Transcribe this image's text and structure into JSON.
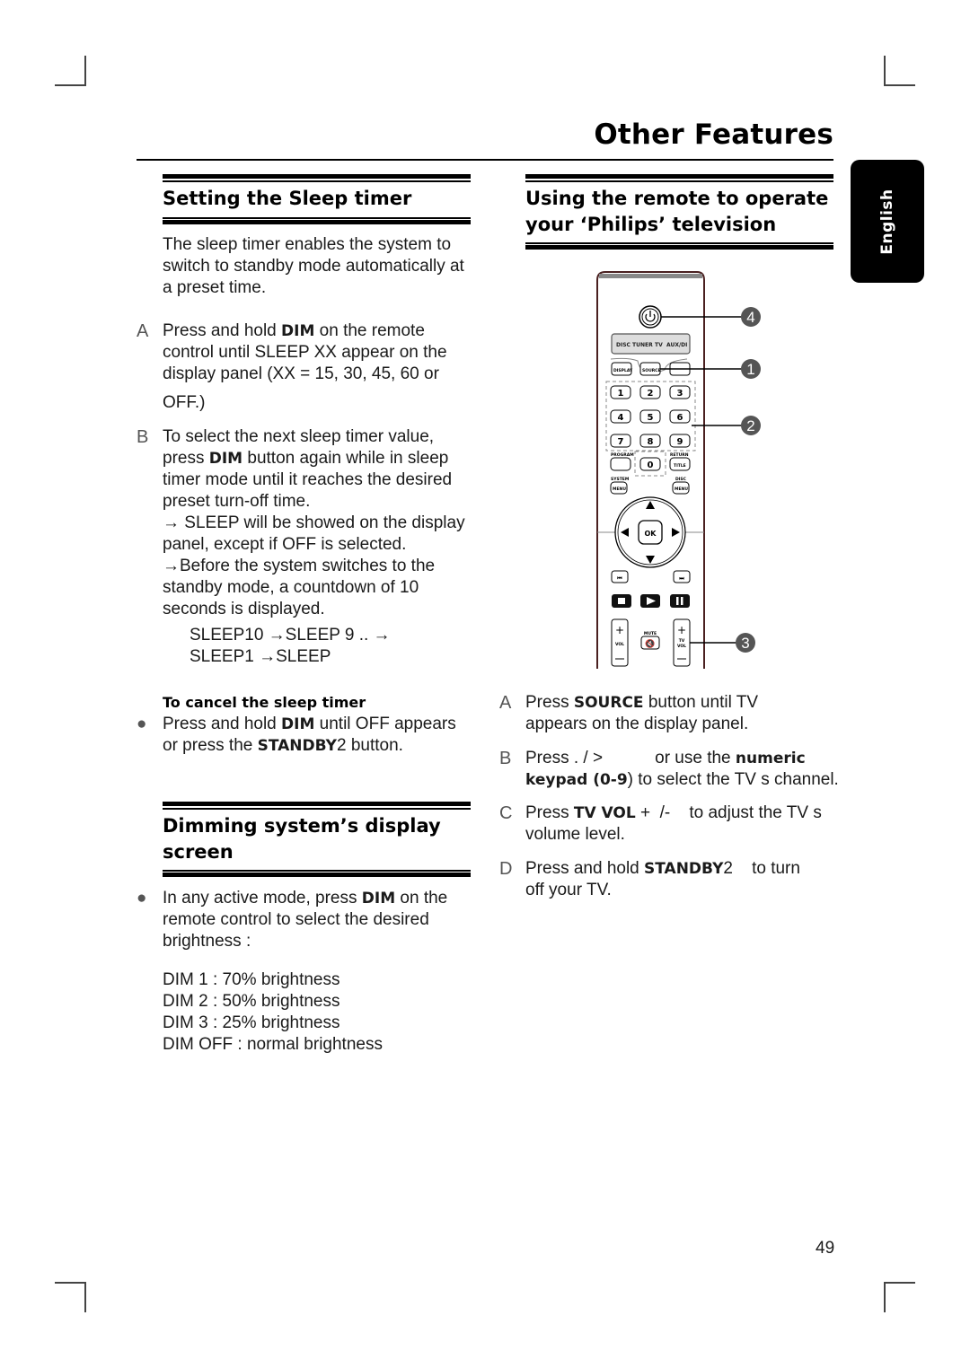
{
  "header": {
    "title": "Other Features",
    "language_tab": "English"
  },
  "left": {
    "sleep_section": {
      "title": "Setting the Sleep timer",
      "intro": [
        "The sleep timer enables the system to",
        "switch to standby mode automatically at",
        "a preset time."
      ],
      "steps": [
        {
          "letter": "A",
          "lines": [
            {
              "pre": "Press and hold ",
              "bold": "DIM",
              "post": " on the remote"
            },
            {
              "pre": "control until  SLEEP XX  appear on the",
              "bold": "",
              "post": ""
            },
            {
              "pre": "display panel (XX = 15, 30, 45, 60 or",
              "bold": "",
              "post": ""
            },
            {
              "pre": "OFF.)",
              "bold": "",
              "post": ""
            }
          ]
        },
        {
          "letter": "B",
          "lines": [
            {
              "pre": "To select the next sleep timer value,",
              "bold": "",
              "post": ""
            },
            {
              "pre": "press ",
              "bold": "DIM",
              "post": " button again while in sleep"
            },
            {
              "pre": "timer mode until it reaches the desired",
              "bold": "",
              "post": ""
            },
            {
              "pre": "preset turn-off time.",
              "bold": "",
              "post": ""
            },
            {
              "pre": "→ SLEEP  will be showed on the display",
              "bold": "",
              "post": ""
            },
            {
              "pre": "panel, except if  OFF  is selected.",
              "bold": "",
              "post": ""
            },
            {
              "pre": "→Before the system switches to the",
              "bold": "",
              "post": ""
            },
            {
              "pre": "standby mode, a countdown of 10",
              "bold": "",
              "post": ""
            },
            {
              "pre": "seconds is displayed.",
              "bold": "",
              "post": ""
            }
          ]
        }
      ],
      "countdown": [
        "SLEEP10 →SLEEP 9 .. →",
        "SLEEP1 →SLEEP"
      ],
      "cancel": {
        "title": "To cancel the sleep timer",
        "lines": [
          {
            "pre": "Press and hold ",
            "bold": "DIM",
            "post": " until  OFF  appears"
          },
          {
            "pre": "or press the ",
            "bold": "STANDBY",
            "post": "2    button."
          }
        ]
      }
    },
    "dim_section": {
      "title_lines": [
        "Dimming system’s display",
        "screen"
      ],
      "lines": [
        {
          "pre": "In any active mode, press ",
          "bold": "DIM",
          "post": " on the"
        },
        {
          "pre": "remote control to select the desired",
          "bold": "",
          "post": ""
        },
        {
          "pre": "brightness :",
          "bold": "",
          "post": ""
        }
      ],
      "levels": [
        {
          "name": "DIM 1",
          "value": "70% brightness"
        },
        {
          "name": "DIM 2",
          "value": "50% brightness"
        },
        {
          "name": "DIM 3",
          "value": "25% brightness"
        },
        {
          "name": "DIM OFF",
          "value": "normal brightness"
        }
      ]
    }
  },
  "right": {
    "tv_section": {
      "title_lines": [
        "Using the remote to operate",
        "your ‘Philips’ television"
      ],
      "remote": {
        "display_labels": [
          "DISC",
          "TUNER",
          "TV",
          "AUX/DI"
        ],
        "buttons": {
          "display": "DISPLAY",
          "source": "SOURCE",
          "program": "PROGRAM",
          "return": "RETURN",
          "title": "TITLE",
          "system": "SYSTEM",
          "menu": "MENU",
          "disc": "DISC",
          "ok": "OK",
          "mute": "MUTE",
          "vol": "VOL",
          "tv": "TV"
        },
        "keypad": [
          "1",
          "2",
          "3",
          "4",
          "5",
          "6",
          "7",
          "8",
          "9",
          "0"
        ],
        "callouts": [
          "4",
          "1",
          "2",
          "3"
        ]
      },
      "steps": [
        {
          "letter": "A",
          "lines": [
            {
              "pre": "Press ",
              "bold": "SOURCE",
              "post": " button until  TV"
            },
            {
              "pre": "appears on the display panel.",
              "bold": "",
              "post": ""
            }
          ]
        },
        {
          "letter": "B",
          "lines": [
            {
              "pre": "Press . / >           or use the ",
              "bold": "numeric",
              "post": ""
            },
            {
              "pre": "",
              "bold": "keypad (0-9",
              "post": ") to select the TV s channel."
            }
          ]
        },
        {
          "letter": "C",
          "lines": [
            {
              "pre": "Press ",
              "bold": "TV VOL",
              "post": " +  /-    to adjust the TV s"
            },
            {
              "pre": "volume level.",
              "bold": "",
              "post": ""
            }
          ]
        },
        {
          "letter": "D",
          "lines": [
            {
              "pre": "Press and hold ",
              "bold": "STANDBY",
              "post": "2    to turn"
            },
            {
              "pre": "off your TV.",
              "bold": "",
              "post": ""
            }
          ]
        }
      ]
    }
  },
  "footer": {
    "page_number": "49"
  }
}
